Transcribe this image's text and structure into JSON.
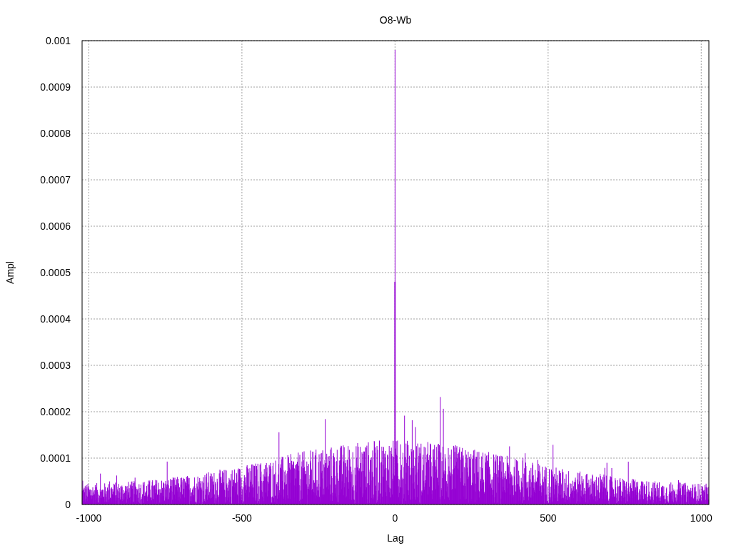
{
  "plot": {
    "title": "O8-Wb",
    "xlabel": "Lag",
    "ylabel": "Ampl",
    "xtick_labels": [
      "-1000",
      "-500",
      "0",
      "500",
      "1000"
    ],
    "ytick_labels": [
      "0.001",
      "0.0009",
      "0.0008",
      "0.0007",
      "0.0006",
      "0.0005",
      "0.0004",
      "0.0003",
      "0.0002",
      "0.0001",
      "0"
    ]
  }
}
